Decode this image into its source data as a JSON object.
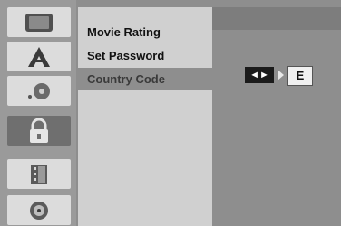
{
  "rail": {
    "icons": [
      {
        "name": "general-tv-icon"
      },
      {
        "name": "audio-language-icon"
      },
      {
        "name": "disc-audio-icon"
      },
      {
        "name": "lock-icon"
      },
      {
        "name": "film-record-icon"
      },
      {
        "name": "disc-icon"
      }
    ],
    "active_index": 3
  },
  "menu": {
    "items": [
      {
        "label": "Movie Rating"
      },
      {
        "label": "Set Password"
      },
      {
        "label": "Country Code"
      }
    ],
    "selected_index": 2
  },
  "country_code": {
    "selector_label": "◄►",
    "value": "E"
  }
}
